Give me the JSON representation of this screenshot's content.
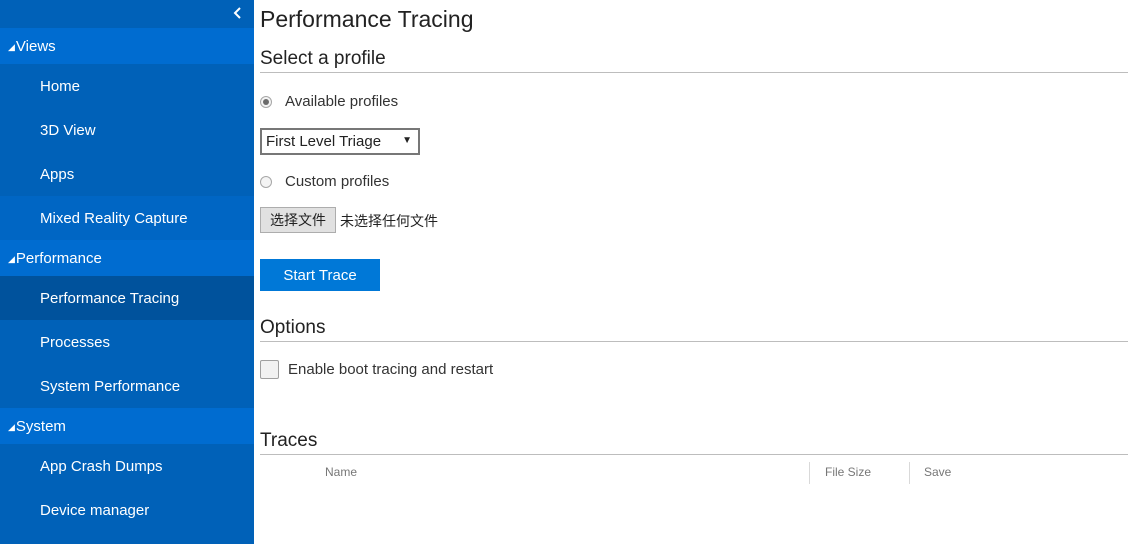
{
  "sidebar": {
    "groups": [
      {
        "label": "Views",
        "items": [
          "Home",
          "3D View",
          "Apps",
          "Mixed Reality Capture"
        ]
      },
      {
        "label": "Performance",
        "items": [
          "Performance Tracing",
          "Processes",
          "System Performance"
        ]
      },
      {
        "label": "System",
        "items": [
          "App Crash Dumps",
          "Device manager"
        ]
      }
    ],
    "active_item": "Performance Tracing",
    "colors": {
      "background": "#0061b8",
      "group_header": "#006cd0",
      "active": "#00529c"
    }
  },
  "main": {
    "title": "Performance Tracing",
    "select_profile": {
      "heading": "Select a profile",
      "available_label": "Available profiles",
      "available_checked": true,
      "dropdown_value": "First Level Triage",
      "custom_label": "Custom profiles",
      "custom_checked": false,
      "file_button_label": "选择文件",
      "file_status": "未选择任何文件",
      "start_button_label": "Start Trace"
    },
    "options": {
      "heading": "Options",
      "boot_tracing_label": "Enable boot tracing and restart",
      "boot_tracing_checked": false
    },
    "traces": {
      "heading": "Traces",
      "columns": [
        "Name",
        "File Size",
        "Save"
      ],
      "rows": []
    },
    "accent": "#0078d7"
  }
}
